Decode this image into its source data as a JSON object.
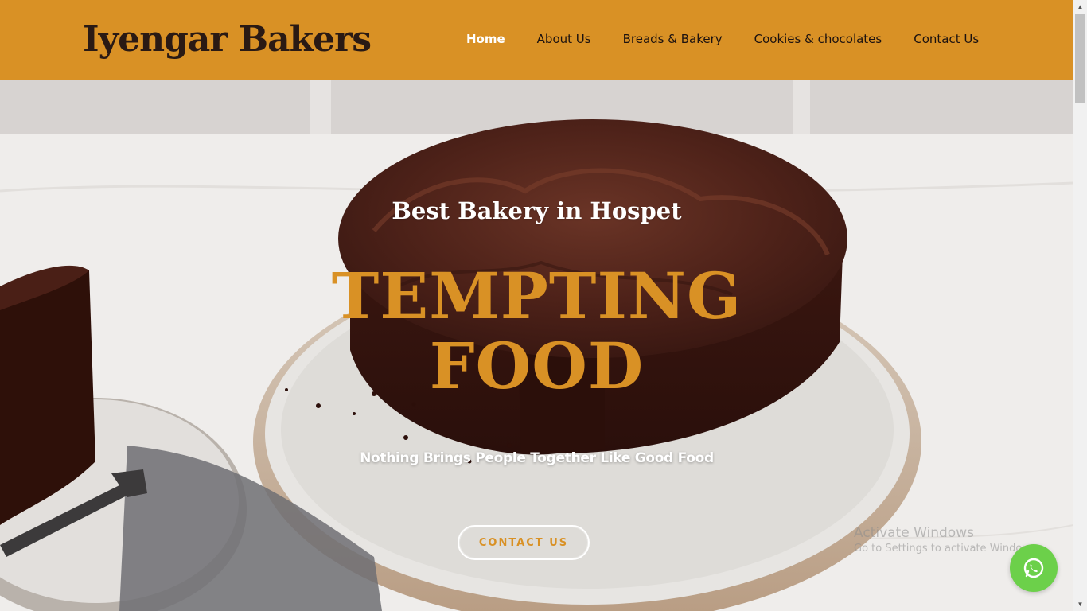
{
  "brand": {
    "name": "Iyengar Bakers"
  },
  "nav": {
    "items": [
      {
        "label": "Home",
        "active": true
      },
      {
        "label": "About Us"
      },
      {
        "label": "Breads & Bakery"
      },
      {
        "label": "Cookies & chocolates"
      },
      {
        "label": "Contact Us"
      }
    ]
  },
  "hero": {
    "subtitle": "Best Bakery in Hospet",
    "headline_line1": "TEMPTING",
    "headline_line2": "FOOD",
    "tagline": "Nothing Brings People Together Like Good Food",
    "cta_label": "CONTACT US",
    "image": "chocolate-cake-photo"
  },
  "watermark": {
    "line1": "Activate Windows",
    "line2": "Go to Settings to activate Windows."
  },
  "floating": {
    "icon": "whatsapp-icon"
  },
  "colors": {
    "accent": "#d99125",
    "brand_text": "#2a1a14",
    "hero_text": "#ffffff",
    "whatsapp": "#6cd04a"
  }
}
